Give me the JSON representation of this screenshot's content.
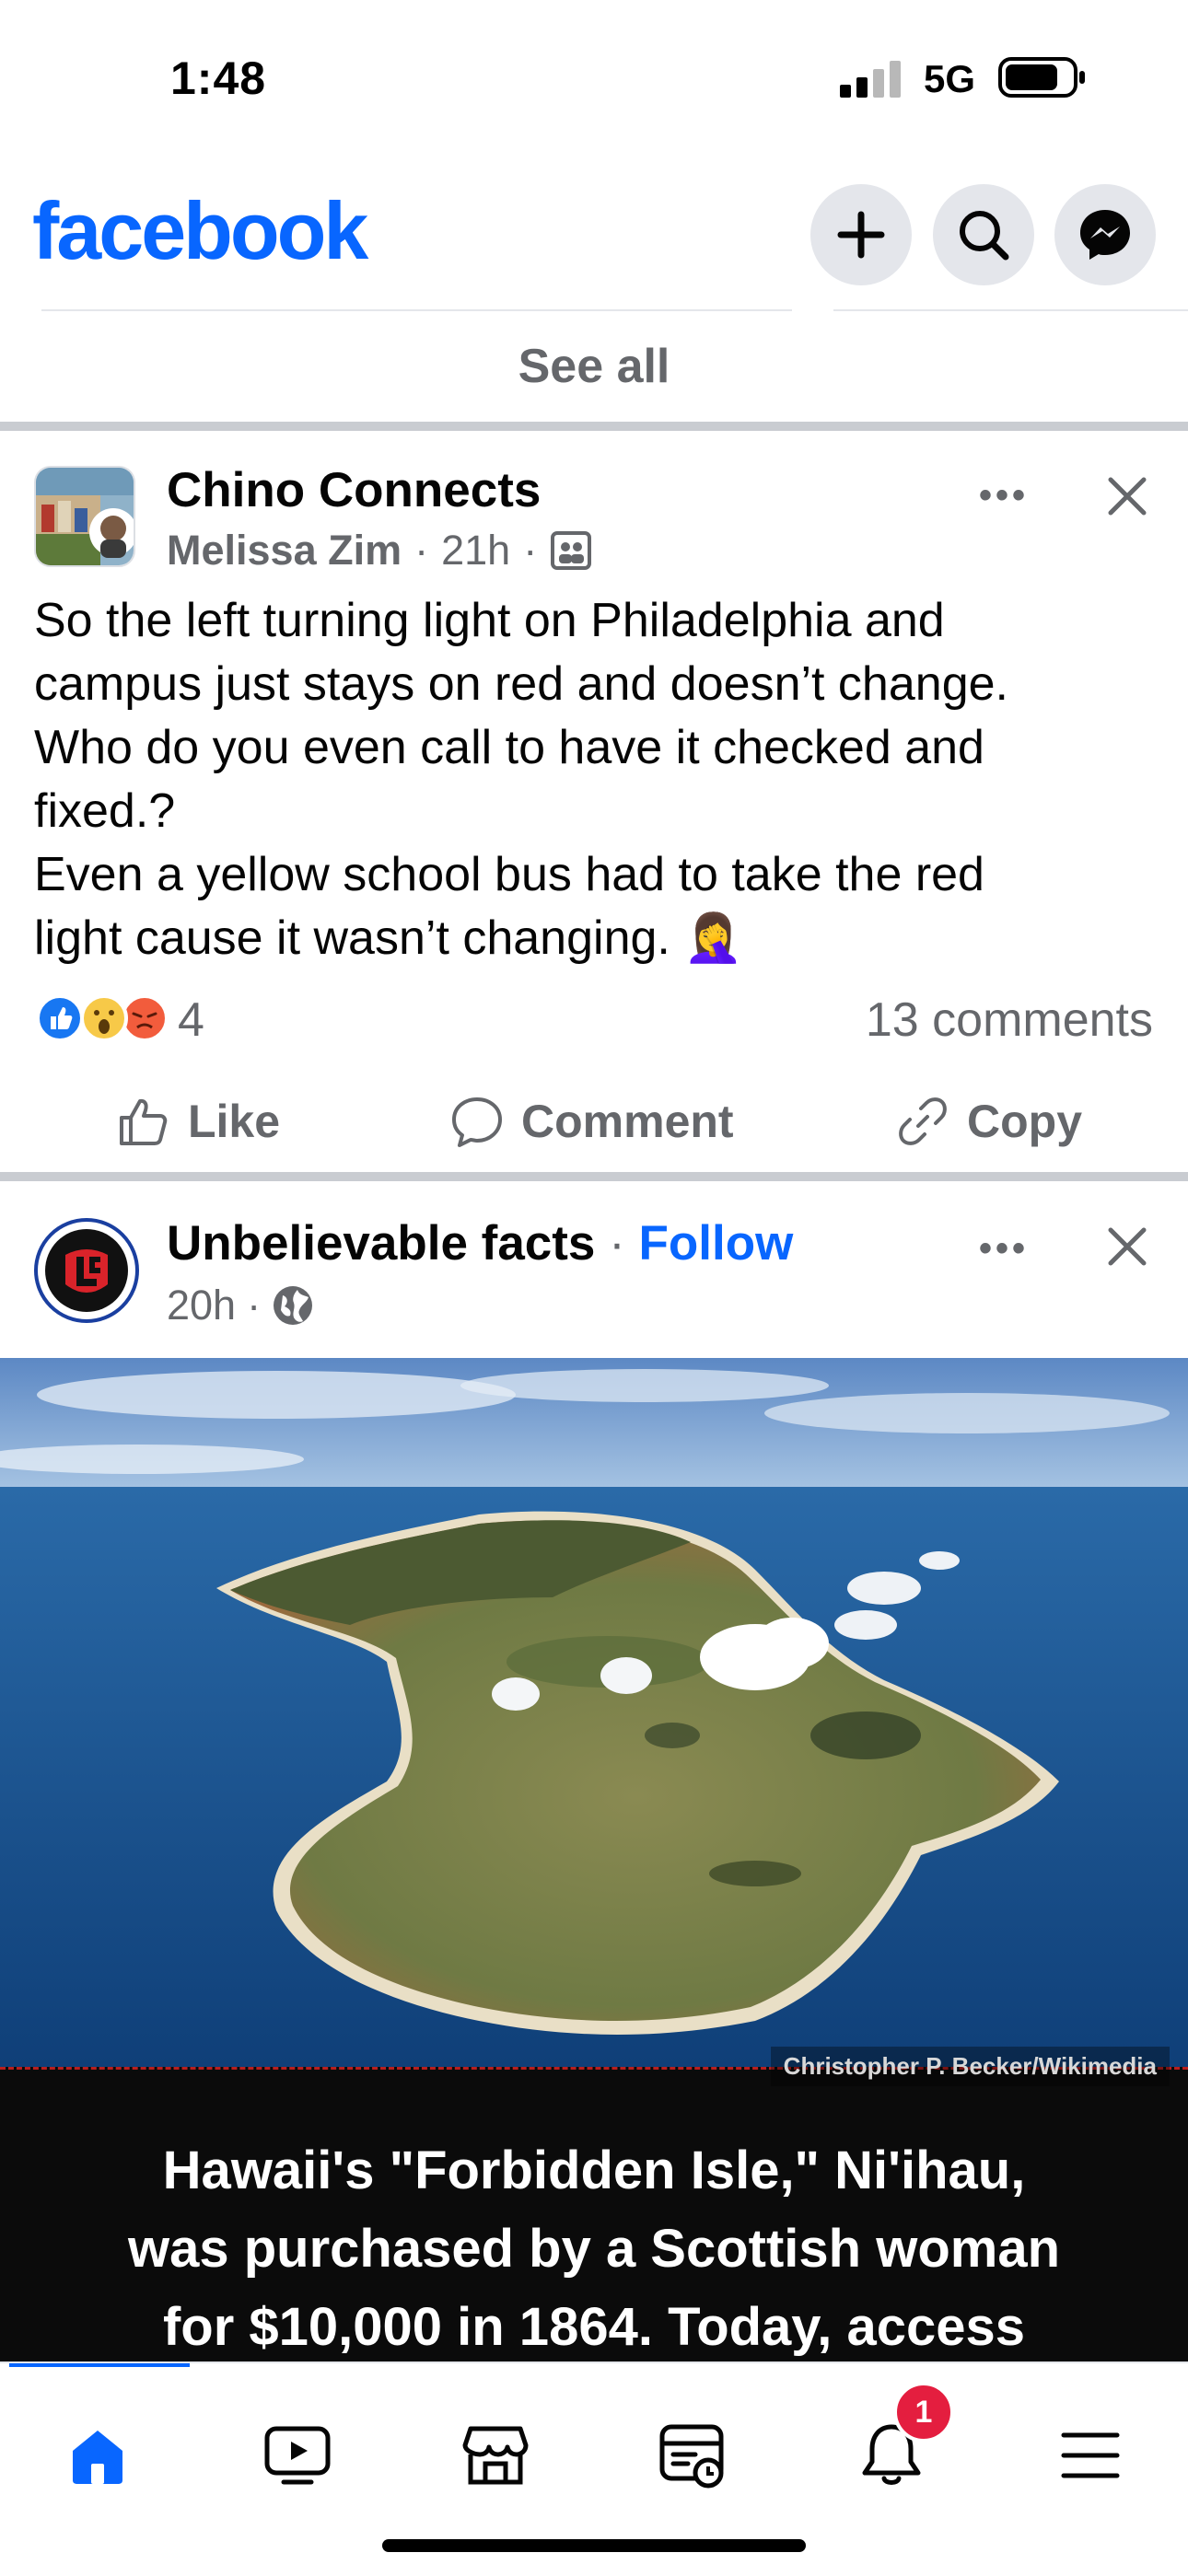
{
  "status_bar": {
    "time": "1:48",
    "network": "5G"
  },
  "header": {
    "logo": "facebook",
    "icons": [
      "plus-icon",
      "search-icon",
      "messenger-icon"
    ]
  },
  "stories": {
    "see_all": "See all"
  },
  "post1": {
    "group": "Chino Connects",
    "author": "Melissa Zim",
    "time": "21h",
    "text_lines": [
      "So the left turning light on Philadelphia and",
      "campus just stays on red and doesn’t change.",
      "Who do you even call to have it checked and",
      "fixed.?",
      "Even a yellow school bus had to take the red",
      "light cause it wasn’t changing.  🤦‍♀️"
    ],
    "reactions": [
      "like",
      "wow",
      "angry"
    ],
    "reaction_count": "4",
    "comments": "13 comments",
    "actions": {
      "like": "Like",
      "comment": "Comment",
      "copy": "Copy"
    }
  },
  "post2": {
    "page": "Unbelievable facts",
    "follow": "Follow",
    "time": "20h",
    "image_credit": "Christopher P. Becker/Wikimedia",
    "caption_lines": [
      "Hawaii's \"Forbidden Isle,\" Ni'ihau,",
      "was purchased by a Scottish woman",
      "for $10,000 in 1864. Today, access"
    ]
  },
  "bottom_nav": {
    "items": [
      "home",
      "video",
      "marketplace",
      "feeds",
      "notifications",
      "menu"
    ],
    "notification_badge": "1"
  },
  "colors": {
    "accent": "#0866ff",
    "secondary_text": "#65676b",
    "badge": "#e41e3f"
  }
}
